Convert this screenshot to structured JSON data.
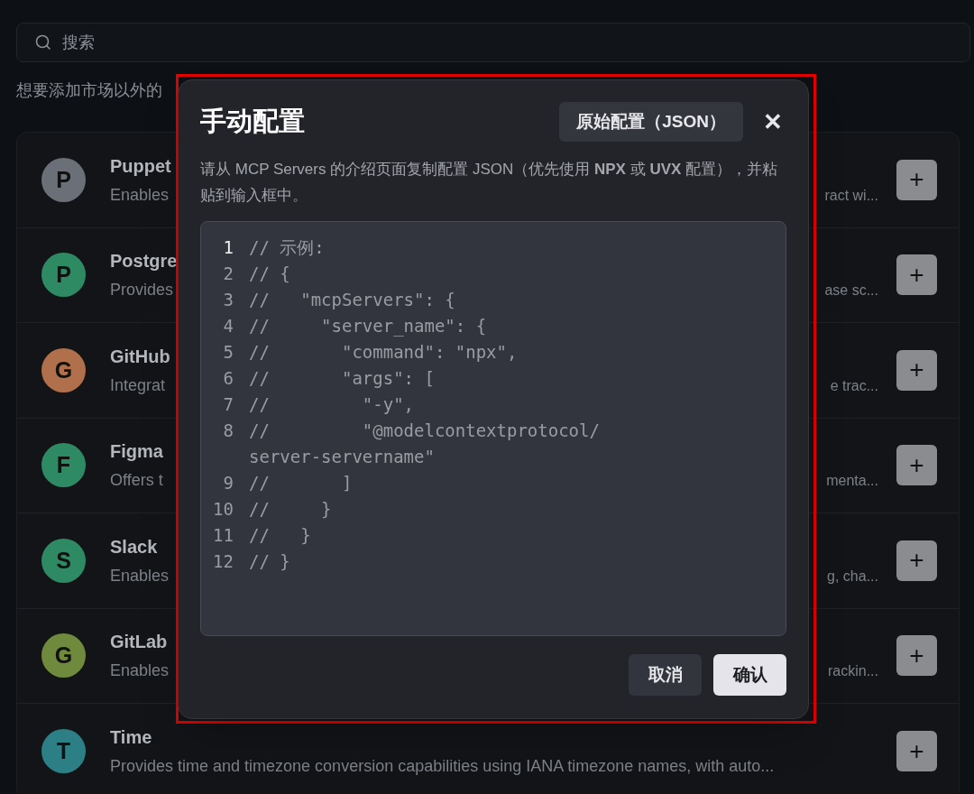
{
  "search": {
    "placeholder": "搜索"
  },
  "hint": "想要添加市场以外的",
  "servers": [
    {
      "initial": "P",
      "color": "#6b7078",
      "name": "Puppet",
      "desc_left": "Enables",
      "desc_right": "ract wi..."
    },
    {
      "initial": "P",
      "color": "#2e8a63",
      "name": "Postgre",
      "desc_left": "Provides",
      "desc_right": "ase sc..."
    },
    {
      "initial": "G",
      "color": "#b0704b",
      "name": "GitHub",
      "desc_left": "Integrat",
      "desc_right": "e trac..."
    },
    {
      "initial": "F",
      "color": "#2e8a63",
      "name": "Figma",
      "desc_left": "Offers t",
      "desc_right": "menta..."
    },
    {
      "initial": "S",
      "color": "#2e8a63",
      "name": "Slack",
      "desc_left": "Enables",
      "desc_right": "g, cha..."
    },
    {
      "initial": "G",
      "color": "#6f8a3d",
      "name": "GitLab",
      "desc_left": "Enables",
      "desc_right": "rackin..."
    },
    {
      "initial": "T",
      "color": "#2d7f86",
      "name": "Time",
      "desc_left": "Provides time and timezone conversion capabilities using IANA timezone names, with auto..."
    }
  ],
  "add_button": "+",
  "dialog": {
    "title": "手动配置",
    "raw_button": "原始配置（JSON）",
    "close": "✕",
    "description": "请从 MCP Servers 的介绍页面复制配置 JSON（优先使用 **NPX** 或 **UVX** 配置），并粘贴到输入框中。",
    "code_lines": [
      {
        "number": "1",
        "text": "// 示例:",
        "active": true
      },
      {
        "number": "2",
        "text": "// {",
        "active": false
      },
      {
        "number": "3",
        "text": "//   \"mcpServers\": {",
        "active": false
      },
      {
        "number": "4",
        "text": "//     \"server_name\": {",
        "active": false
      },
      {
        "number": "5",
        "text": "//       \"command\": \"npx\",",
        "active": false
      },
      {
        "number": "6",
        "text": "//       \"args\": [",
        "active": false
      },
      {
        "number": "7",
        "text": "//         \"-y\",",
        "active": false
      },
      {
        "number": "8",
        "text": "//         \"@modelcontextprotocol/",
        "wrapped": "server-servername\"",
        "active": false
      },
      {
        "number": "9",
        "text": "//       ]",
        "active": false
      },
      {
        "number": "10",
        "text": "//     }",
        "active": false
      },
      {
        "number": "11",
        "text": "//   }",
        "active": false
      },
      {
        "number": "12",
        "text": "// }",
        "active": false
      }
    ],
    "cancel": "取消",
    "confirm": "确认"
  }
}
